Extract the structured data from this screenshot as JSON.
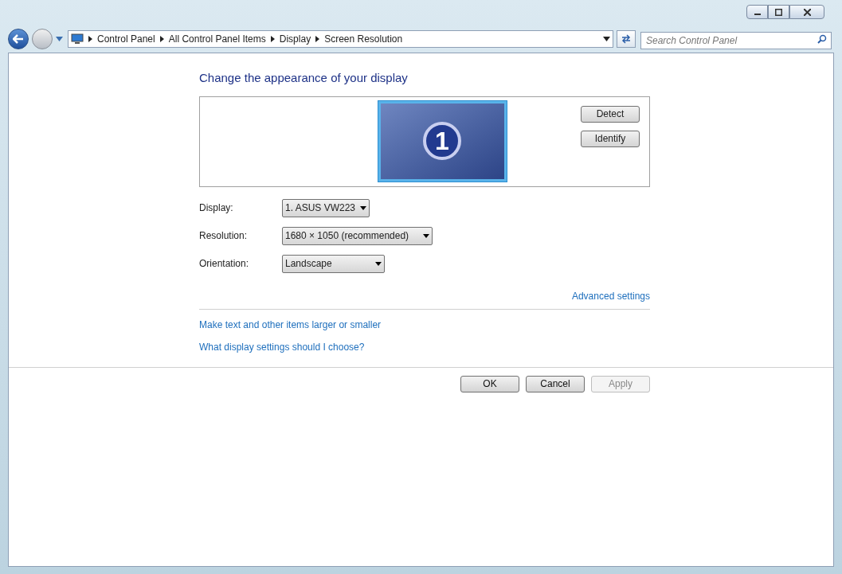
{
  "breadcrumb": [
    "Control Panel",
    "All Control Panel Items",
    "Display",
    "Screen Resolution"
  ],
  "search": {
    "placeholder": "Search Control Panel"
  },
  "heading": "Change the appearance of your display",
  "monitor": {
    "label": "1",
    "selected": true
  },
  "monitor_buttons": [
    "Detect",
    "Identify"
  ],
  "settings": [
    {
      "label": "Display:",
      "value": "1. ASUS VW223"
    },
    {
      "label": "Resolution:",
      "value": "1680 × 1050 (recommended)"
    },
    {
      "label": "Orientation:",
      "value": "Landscape"
    }
  ],
  "advanced_link": "Advanced settings",
  "links": [
    "Make text and other items larger or smaller",
    "What display settings should I choose?"
  ],
  "buttons": [
    {
      "label": "OK",
      "disabled": false
    },
    {
      "label": "Cancel",
      "disabled": false
    },
    {
      "label": "Apply",
      "disabled": true
    }
  ]
}
